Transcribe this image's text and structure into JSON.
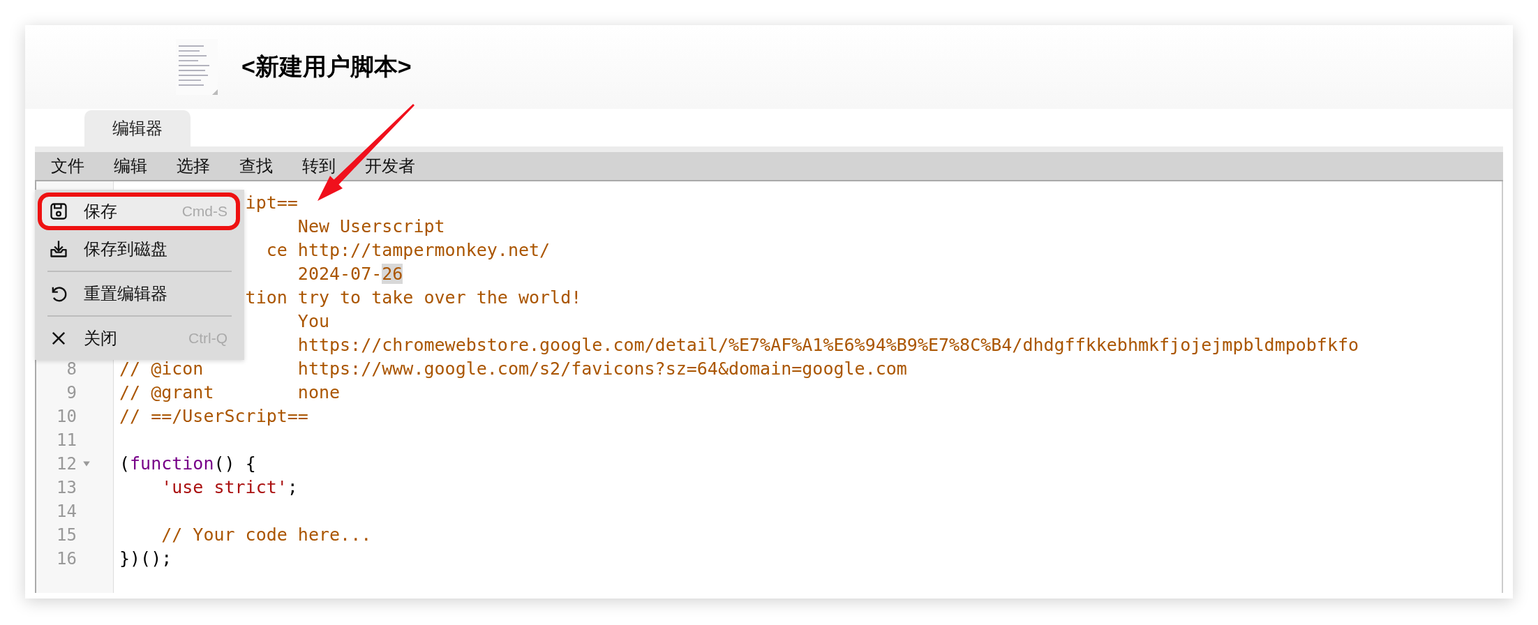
{
  "header": {
    "title": "<新建用户脚本>"
  },
  "tabs": [
    {
      "label": "编辑器",
      "selected": true
    }
  ],
  "menubar": [
    {
      "label": "文件"
    },
    {
      "label": "编辑"
    },
    {
      "label": "选择"
    },
    {
      "label": "查找"
    },
    {
      "label": "转到"
    },
    {
      "label": "开发者"
    }
  ],
  "menu": {
    "groups": [
      [
        {
          "kind": "save",
          "label": "保存",
          "shortcut": "Cmd-S",
          "highlighted": true
        },
        {
          "kind": "download",
          "label": "保存到磁盘",
          "highlighted": false
        }
      ],
      [
        {
          "kind": "reset",
          "label": "重置编辑器",
          "highlighted": false
        }
      ],
      [
        {
          "kind": "close",
          "label": "关闭",
          "shortcut": "Ctrl-Q",
          "highlighted": false
        }
      ]
    ]
  },
  "editor": {
    "lines": [
      {
        "covered": true,
        "key": "ipt=="
      },
      {
        "covered": true,
        "tokens": [
          {
            "kind": "comment",
            "text": "New Userscript"
          }
        ]
      },
      {
        "covered": true,
        "key": "ce",
        "tokens": [
          {
            "kind": "comment",
            "text": "http://tampermonkey.net/"
          }
        ]
      },
      {
        "covered": true,
        "tokens": [
          {
            "kind": "comment",
            "text": "2024-07-"
          },
          {
            "kind": "match",
            "text": "26"
          }
        ]
      },
      {
        "covered": true,
        "key": "tion",
        "tokens": [
          {
            "kind": "comment",
            "text": "try to take over the world!"
          }
        ]
      },
      {
        "covered": true,
        "tokens": [
          {
            "kind": "comment",
            "text": "You"
          }
        ]
      },
      {
        "covered": true,
        "tokens": [
          {
            "kind": "comment",
            "text": "https://chromewebstore.google.com/detail/%E7%AF%A1%E6%94%B9%E7%8C%B4/dhdgffkkebhmkfjojejmpbldmpobfkfo"
          }
        ]
      },
      {
        "number": "8",
        "covered": false,
        "key": "// @icon",
        "tokens": [
          {
            "kind": "comment",
            "text": "https://www.google.com/s2/favicons?sz=64&domain=google.com"
          }
        ]
      },
      {
        "number": "9",
        "covered": false,
        "key": "// @grant",
        "tokens": [
          {
            "kind": "comment",
            "text": "none"
          }
        ]
      },
      {
        "number": "10",
        "covered": false,
        "tokens": [
          {
            "kind": "comment",
            "text": "// ==/UserScript=="
          }
        ]
      },
      {
        "number": "11"
      },
      {
        "number": "12",
        "foldable": true,
        "tokens": [
          {
            "kind": "plain",
            "text": "("
          },
          {
            "kind": "keyword",
            "text": "function"
          },
          {
            "kind": "plain",
            "text": "() {"
          }
        ]
      },
      {
        "number": "13",
        "indented": true,
        "tokens": [
          {
            "kind": "string",
            "text": "'use strict'"
          },
          {
            "kind": "plain",
            "text": ";"
          }
        ]
      },
      {
        "number": "14"
      },
      {
        "number": "15",
        "indented": true,
        "tokens": [
          {
            "kind": "comment",
            "text": "// Your code here..."
          }
        ]
      },
      {
        "number": "16",
        "indented": false,
        "tokens": [
          {
            "kind": "plain",
            "text": "})();"
          }
        ]
      }
    ]
  }
}
